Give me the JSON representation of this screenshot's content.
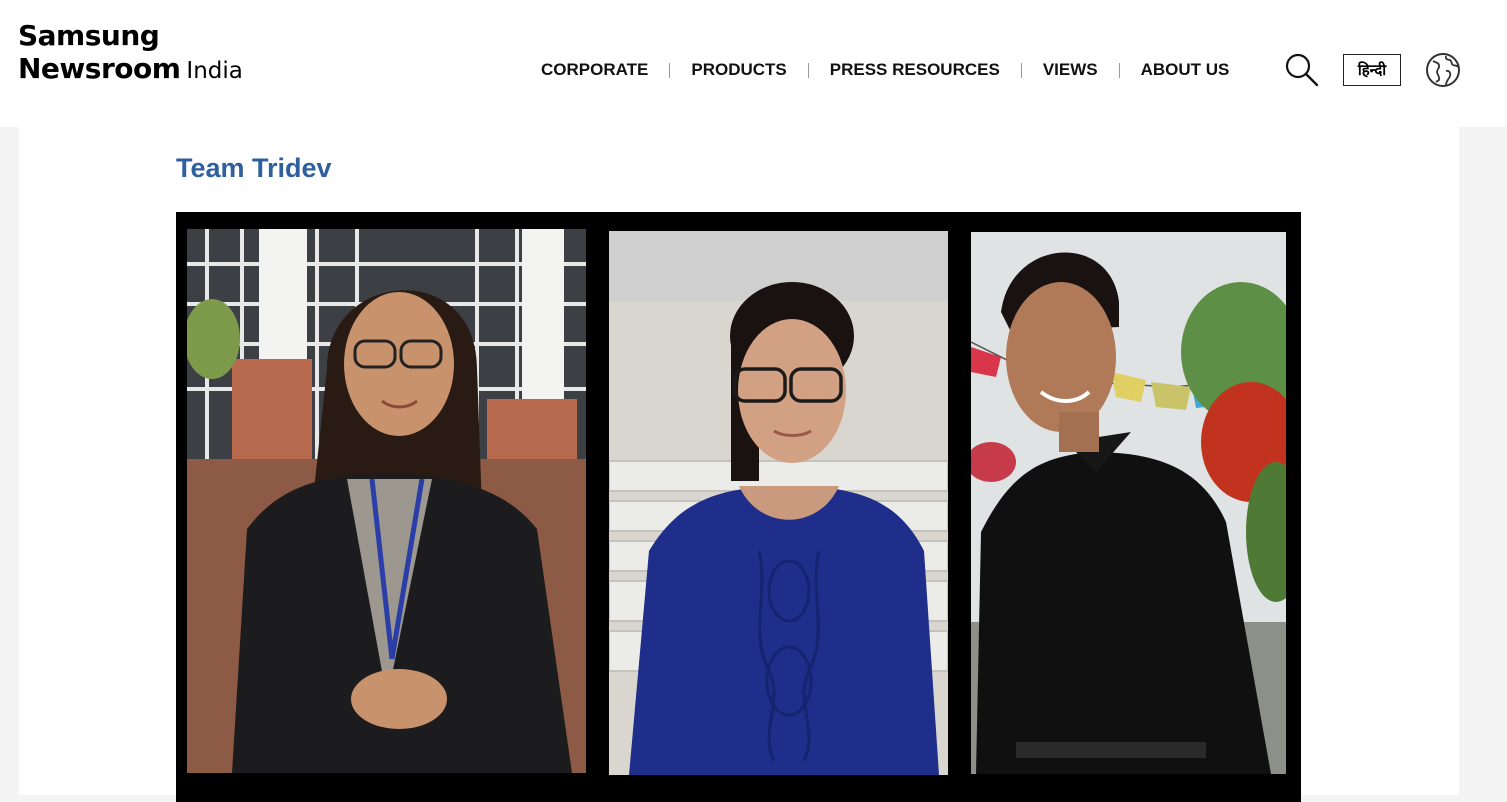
{
  "header": {
    "logo": {
      "brand": "Samsung",
      "product": "Newsroom",
      "region": "India"
    },
    "nav": [
      {
        "label": "CORPORATE"
      },
      {
        "label": "PRODUCTS"
      },
      {
        "label": "PRESS RESOURCES"
      },
      {
        "label": "VIEWS"
      },
      {
        "label": "ABOUT US"
      }
    ],
    "search_icon": "search-icon",
    "language_button": "हिन्दी",
    "globe_icon": "globe-icon"
  },
  "article": {
    "section_title": "Team Tridev",
    "photos": [
      {
        "name": "photo-member-1",
        "colors": {
          "bg": "#8c6a55",
          "outfit": "#1c1c1e",
          "hair": "#2a1a14"
        }
      },
      {
        "name": "photo-member-2",
        "colors": {
          "bg": "#d9d6d0",
          "outfit": "#1f2e8a",
          "hair": "#1a1210"
        }
      },
      {
        "name": "photo-member-3",
        "colors": {
          "bg": "#cfd6d6",
          "outfit": "#101010",
          "hair": "#1a1210"
        }
      }
    ]
  },
  "colors": {
    "title_blue": "#2e5f9e",
    "page_bg": "#f4f4f4",
    "frame": "#000000"
  }
}
